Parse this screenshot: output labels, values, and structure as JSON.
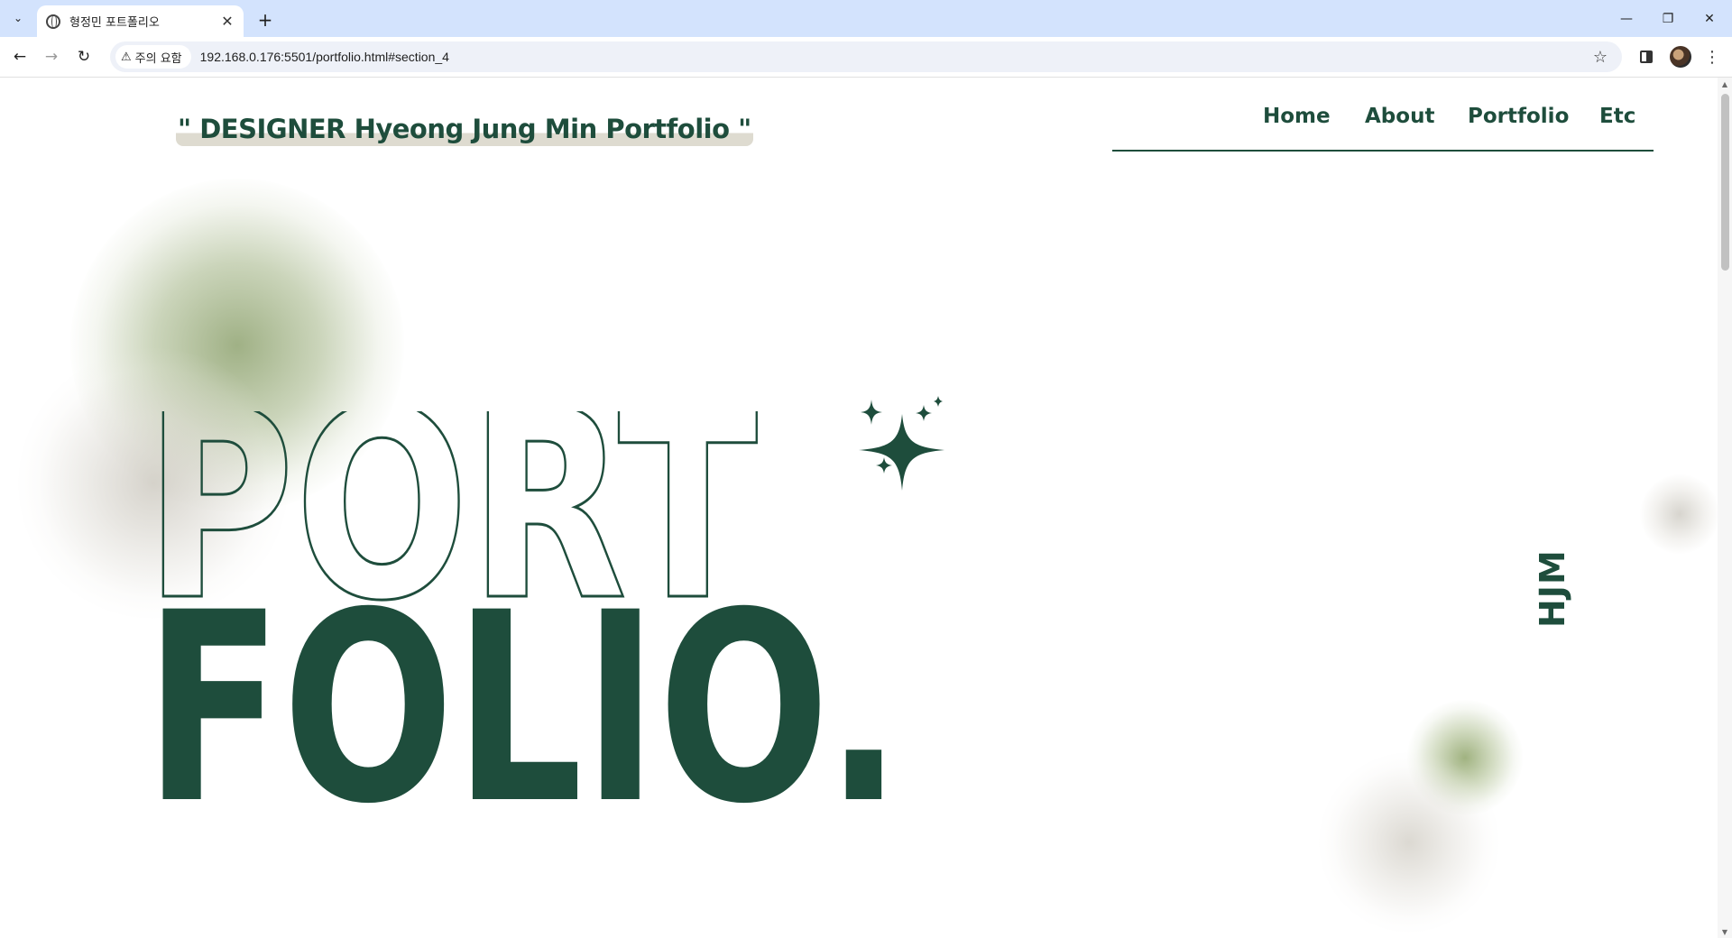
{
  "browser": {
    "tab_title": "형정민 포트폴리오",
    "new_tab_symbol": "+",
    "security_label": "주의 요함",
    "url": "192.168.0.176:5501/portfolio.html#section_4",
    "icons": [
      "tab-list-icon",
      "globe-icon",
      "close-icon",
      "plus-icon",
      "minimize-icon",
      "restore-icon",
      "window-close-icon",
      "back-icon",
      "forward-icon",
      "reload-icon",
      "warning-icon",
      "star-icon",
      "side-panel-icon",
      "profile-avatar",
      "more-menu-icon"
    ]
  },
  "page": {
    "site_title": "\" DESIGNER Hyeong Jung Min Portfolio \"",
    "nav": [
      "Home",
      "About",
      "Portfolio",
      "Etc"
    ],
    "hero_line_1": "PORT",
    "hero_line_2": "FOLIO.",
    "vertical_tag": "HJM",
    "colors": {
      "primary": "#1e4d3c",
      "highlight": "#dedbd0",
      "orb_green": "#8fa370",
      "orb_beige": "#c8c4ba"
    }
  }
}
